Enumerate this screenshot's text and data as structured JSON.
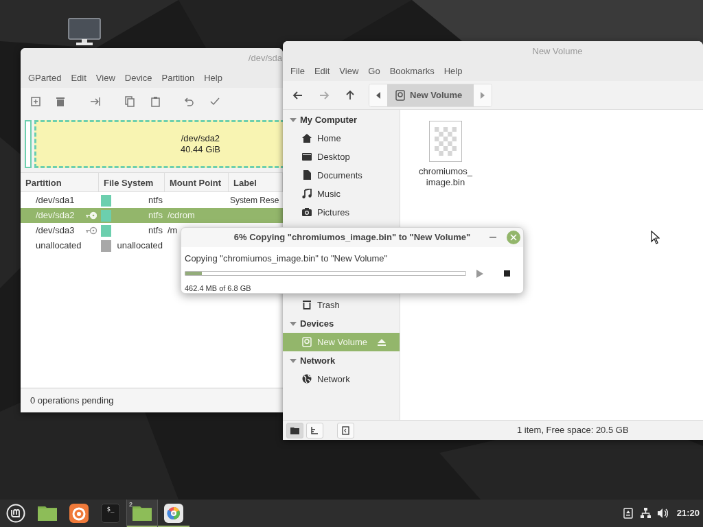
{
  "gparted": {
    "title": "/dev/sda",
    "menu": [
      "GParted",
      "Edit",
      "View",
      "Device",
      "Partition",
      "Help"
    ],
    "toolbar": [
      {
        "kind": "new"
      },
      {
        "kind": "delete"
      },
      {
        "kind": "resize"
      },
      {
        "kind": "copy"
      },
      {
        "kind": "paste"
      },
      {
        "kind": "undo"
      },
      {
        "kind": "apply"
      }
    ],
    "disk_map": {
      "name": "/dev/sda2",
      "size": "40.44 GiB"
    },
    "table": {
      "columns": [
        "Partition",
        "File System",
        "Mount Point",
        "Label"
      ],
      "rows": [
        {
          "partition": "/dev/sda1",
          "mounted": false,
          "color": "#6ccfae",
          "file_system": "ntfs",
          "mount_point": "",
          "label": "System Rese",
          "selected": false
        },
        {
          "partition": "/dev/sda2",
          "mounted": true,
          "color": "#6ccfae",
          "file_system": "ntfs",
          "mount_point": "/cdrom",
          "label": "",
          "selected": true
        },
        {
          "partition": "/dev/sda3",
          "mounted": true,
          "color": "#6ccfae",
          "file_system": "ntfs",
          "mount_point": "/m",
          "label": "",
          "selected": false
        },
        {
          "partition": "unallocated",
          "mounted": false,
          "color": "#a8a8a8",
          "file_system": "unallocated",
          "mount_point": "",
          "label": "",
          "selected": false
        }
      ]
    },
    "status": "0 operations pending"
  },
  "nemo": {
    "title": "New Volume",
    "menu": [
      "File",
      "Edit",
      "View",
      "Go",
      "Bookmarks",
      "Help"
    ],
    "nav": [
      {
        "kind": "back",
        "disabled": false
      },
      {
        "kind": "forward",
        "disabled": true
      },
      {
        "kind": "up",
        "disabled": false
      }
    ],
    "path": {
      "label": "New Volume"
    },
    "sidebar": [
      {
        "title": "My Computer",
        "expanded": true,
        "items": [
          {
            "label": "Home",
            "kind": "home",
            "selected": false
          },
          {
            "label": "Desktop",
            "kind": "desktop",
            "selected": false
          },
          {
            "label": "Documents",
            "kind": "document",
            "selected": false
          },
          {
            "label": "Music",
            "kind": "music",
            "selected": false
          },
          {
            "label": "Pictures",
            "kind": "camera",
            "selected": false
          },
          {
            "label": "Trash",
            "kind": "trash",
            "selected": false
          }
        ]
      },
      {
        "title": "Devices",
        "expanded": true,
        "items": [
          {
            "label": "New Volume",
            "kind": "drive",
            "selected": true,
            "eject": true
          }
        ]
      },
      {
        "title": "Network",
        "expanded": true,
        "items": [
          {
            "label": "Network",
            "kind": "globe",
            "selected": false
          }
        ]
      }
    ],
    "files": [
      {
        "lines": [
          "chromiumos_",
          "image.bin"
        ],
        "selected": false
      }
    ],
    "view_buttons": [
      {
        "kind": "places",
        "selected": true
      },
      {
        "kind": "tree",
        "selected": false
      },
      {
        "kind": "toggle",
        "selected": false
      }
    ],
    "status": "1 item, Free space: 20.5 GB"
  },
  "dialog": {
    "title": "6% Copying \"chromiumos_image.bin\" to \"New Volume\"",
    "message": "Copying \"chromiumos_image.bin\" to \"New Volume\"",
    "level": 0.06,
    "detail": "462.4 MB of 6.8 GB"
  },
  "taskbar": {
    "apps": [
      {
        "kind": "menu",
        "active": false,
        "running": false
      },
      {
        "kind": "folder",
        "active": false,
        "running": false
      },
      {
        "kind": "browser",
        "active": false,
        "running": false
      },
      {
        "kind": "terminal",
        "text": "$_",
        "active": false,
        "running": false
      },
      {
        "kind": "folder",
        "badge": "2",
        "active": true,
        "running": true
      },
      {
        "kind": "disc",
        "active": false,
        "running": true
      }
    ],
    "tray": [
      {
        "kind": "eject"
      },
      {
        "kind": "network"
      },
      {
        "kind": "volume"
      }
    ],
    "clock": "21:20"
  }
}
